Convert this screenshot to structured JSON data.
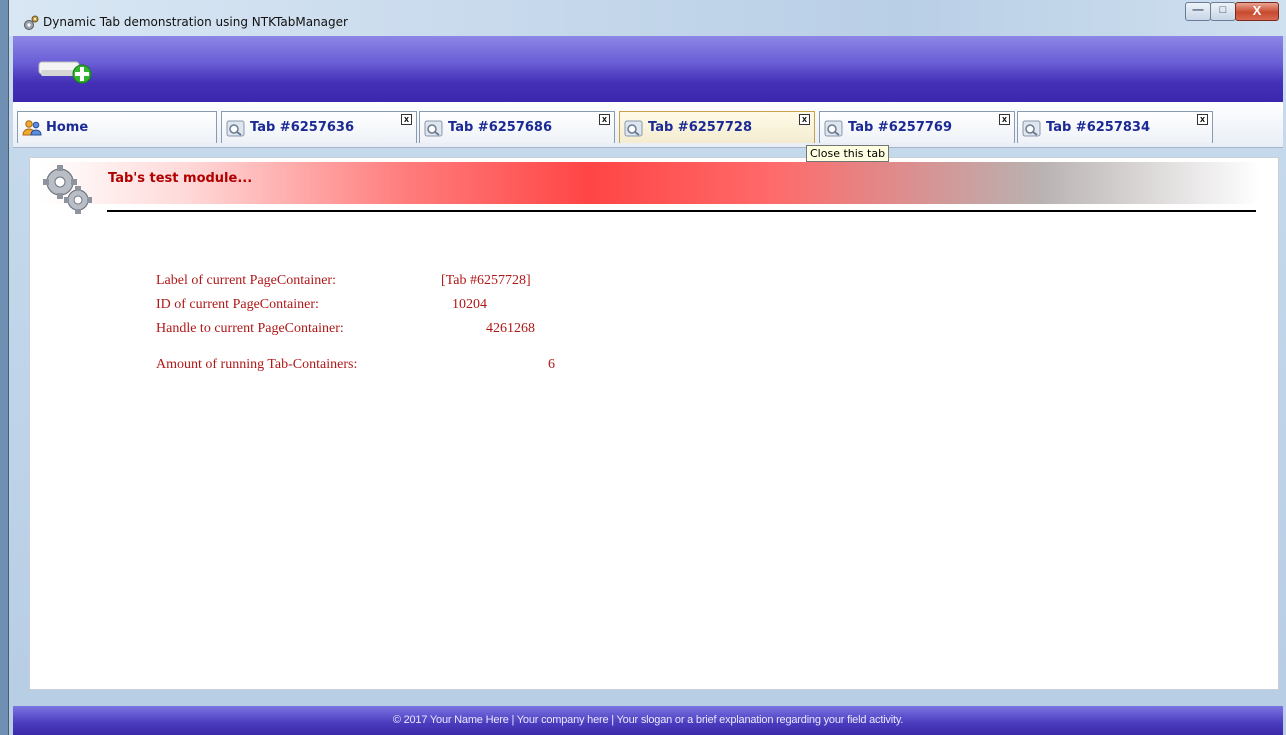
{
  "window": {
    "title": "Dynamic Tab demonstration using NTKTabManager",
    "controls": {
      "minimize": "—",
      "maximize": "□",
      "close": "X"
    }
  },
  "toolbar": {
    "add_button_icon": "add-module-icon"
  },
  "tabs": [
    {
      "label": "Home",
      "icon": "users-icon",
      "closable": false,
      "active": false
    },
    {
      "label": "Tab #6257636",
      "icon": "search-gear-icon",
      "closable": true,
      "active": false
    },
    {
      "label": "Tab #6257686",
      "icon": "search-gear-icon",
      "closable": true,
      "active": false
    },
    {
      "label": "Tab #6257728",
      "icon": "search-gear-icon",
      "closable": true,
      "active": true
    },
    {
      "label": "Tab #6257769",
      "icon": "search-gear-icon",
      "closable": true,
      "active": false
    },
    {
      "label": "Tab #6257834",
      "icon": "search-gear-icon",
      "closable": true,
      "active": false
    }
  ],
  "tab_close_glyph": "x",
  "tooltip": "Close this tab",
  "module": {
    "title": "Tab's test module...",
    "icon": "gears-icon"
  },
  "info": {
    "label_caption": "Label of current PageContainer:",
    "label_value": "[Tab #6257728]",
    "id_caption": "ID of current PageContainer:",
    "id_value": "10204",
    "handle_caption": "Handle to current PageContainer:",
    "handle_value": "4261268",
    "amount_caption": "Amount of running Tab-Containers:",
    "amount_value": "6"
  },
  "footer": "© 2017 Your Name Here  |  Your company here   |  Your slogan or a brief explanation regarding your field activity.",
  "colors": {
    "toolbar": "#4431b8",
    "info_text": "#b01818",
    "module_title": "#b10000",
    "tab_label": "#1b2a94"
  }
}
